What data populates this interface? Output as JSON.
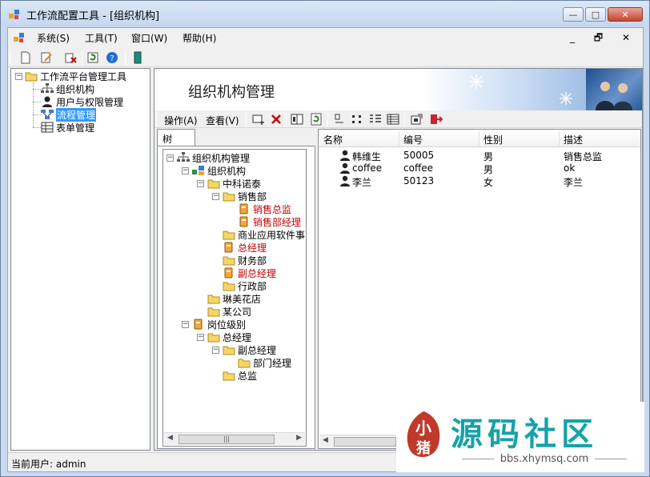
{
  "window": {
    "title": "工作流配置工具 - [组织机构]",
    "buttons": {
      "minimize": "—",
      "maximize": "□",
      "close": "✕"
    }
  },
  "menu": {
    "items": [
      "系统(S)",
      "工具(T)",
      "窗口(W)",
      "帮助(H)"
    ],
    "mdi_buttons": "_ 🗗 ✕"
  },
  "left_tree": {
    "root": "工作流平台管理工具",
    "items": [
      "组织机构",
      "用户与权限管理",
      "流程管理",
      "表单管理"
    ],
    "selected_index": 2
  },
  "banner": {
    "title": "组织机构管理"
  },
  "subtoolbar": {
    "menu_ops": "操作(A)",
    "menu_view": "查看(V)"
  },
  "tree_tab": {
    "label": "树"
  },
  "org_tree": [
    {
      "label": "组织机构管理",
      "level": 0,
      "icon": "org-chart-icon",
      "expander": "minus"
    },
    {
      "label": "组织机构",
      "level": 1,
      "icon": "org-unit-icon",
      "expander": "minus"
    },
    {
      "label": "中科诺泰",
      "level": 2,
      "icon": "folder-icon",
      "expander": "minus"
    },
    {
      "label": "销售部",
      "level": 3,
      "icon": "folder-icon",
      "expander": "minus"
    },
    {
      "label": "销售总监",
      "level": 4,
      "icon": "position-icon",
      "red": true
    },
    {
      "label": "销售部经理",
      "level": 4,
      "icon": "position-icon",
      "red": true
    },
    {
      "label": "商业应用软件事",
      "level": 3,
      "icon": "folder-icon"
    },
    {
      "label": "总经理",
      "level": 3,
      "icon": "position-icon",
      "red": true
    },
    {
      "label": "财务部",
      "level": 3,
      "icon": "folder-icon"
    },
    {
      "label": "副总经理",
      "level": 3,
      "icon": "position-icon",
      "red": true
    },
    {
      "label": "行政部",
      "level": 3,
      "icon": "folder-icon"
    },
    {
      "label": "琳美花店",
      "level": 2,
      "icon": "folder-icon"
    },
    {
      "label": "某公司",
      "level": 2,
      "icon": "folder-icon"
    },
    {
      "label": "岗位级别",
      "level": 1,
      "icon": "position-icon",
      "expander": "minus"
    },
    {
      "label": "总经理",
      "level": 2,
      "icon": "folder-icon",
      "expander": "minus"
    },
    {
      "label": "副总经理",
      "level": 3,
      "icon": "folder-icon",
      "expander": "minus"
    },
    {
      "label": "部门经理",
      "level": 4,
      "icon": "folder-icon"
    },
    {
      "label": "总监",
      "level": 3,
      "icon": "folder-icon"
    }
  ],
  "grid": {
    "columns": [
      "名称",
      "编号",
      "性别",
      "描述"
    ],
    "rows": [
      {
        "name": "韩维生",
        "id": "50005",
        "gender": "男",
        "desc": "销售总监"
      },
      {
        "name": "coffee",
        "id": "coffee",
        "gender": "男",
        "desc": "ok"
      },
      {
        "name": "李兰",
        "id": "50123",
        "gender": "女",
        "desc": "李兰"
      }
    ]
  },
  "status": {
    "text": "当前用户: admin"
  },
  "watermark": {
    "text": "源码社区",
    "url": "bbs.xhymsq.com",
    "seal": "小猪"
  }
}
